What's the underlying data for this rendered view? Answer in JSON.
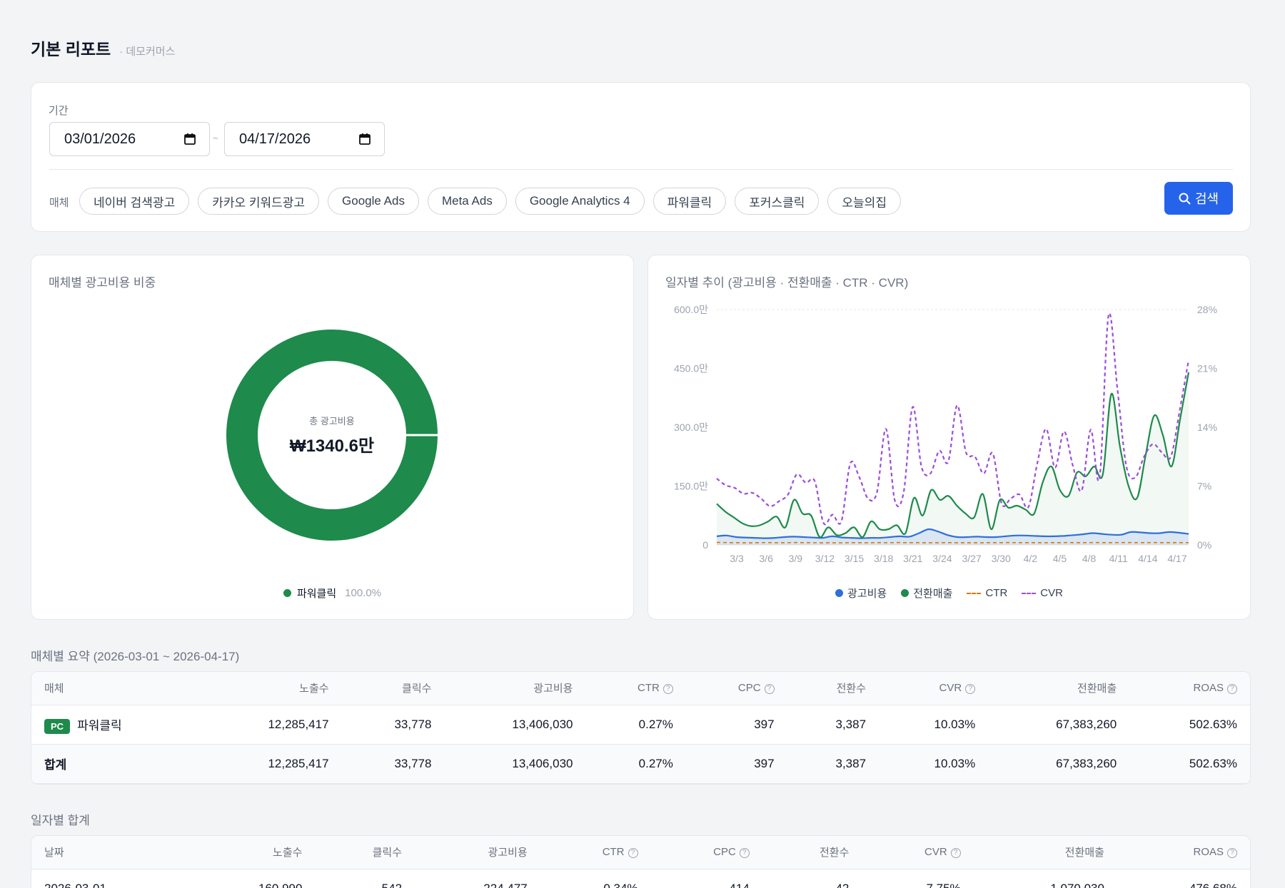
{
  "header": {
    "title": "기본 리포트",
    "subtitle": "· 데모커머스"
  },
  "filter": {
    "period_label": "기간",
    "date_start": "03/01/2026",
    "date_sep": "~",
    "date_end": "04/17/2026",
    "media_label": "매체",
    "chips": [
      "네이버 검색광고",
      "카카오 키워드광고",
      "Google Ads",
      "Meta Ads",
      "Google Analytics 4",
      "파워클릭",
      "포커스클릭",
      "오늘의집"
    ],
    "search_label": "검색",
    "accent_color": "#2563eb"
  },
  "donut": {
    "title": "매체별 광고비용 비중",
    "center_label": "총 광고비용",
    "center_value": "₩1340.6만",
    "legend": [
      {
        "name": "파워클릭",
        "pct": "100.0%",
        "color": "#1e8a4c"
      }
    ]
  },
  "line_chart": {
    "title": "일자별 추이 (광고비용 · 전환매출 · CTR · CVR)",
    "legend": [
      {
        "name": "광고비용",
        "color": "#2f6fdb",
        "style": "dot"
      },
      {
        "name": "전환매출",
        "color": "#1e8a4c",
        "style": "dot"
      },
      {
        "name": "CTR",
        "color": "#d97706",
        "style": "dash"
      },
      {
        "name": "CVR",
        "color": "#9b4ddb",
        "style": "dash"
      }
    ]
  },
  "chart_data": [
    {
      "type": "pie",
      "title": "매체별 광고비용 비중",
      "categories": [
        "파워클릭"
      ],
      "values": [
        100.0
      ],
      "style": "donut"
    },
    {
      "type": "line",
      "title": "일자별 추이 (광고비용 · 전환매출 · CTR · CVR)",
      "x_ticks": [
        "3/3",
        "3/6",
        "3/9",
        "3/12",
        "3/15",
        "3/18",
        "3/21",
        "3/24",
        "3/27",
        "3/30",
        "4/2",
        "4/5",
        "4/8",
        "4/11",
        "4/14",
        "4/17"
      ],
      "y_left_ticks": [
        "0",
        "150.0만",
        "300.0만",
        "450.0만",
        "600.0만"
      ],
      "y_left_lim": [
        0,
        600
      ],
      "y_right_ticks": [
        "0%",
        "7%",
        "14%",
        "21%",
        "28%"
      ],
      "y_right_lim": [
        0,
        28
      ],
      "series": [
        {
          "name": "광고비용",
          "axis": "left",
          "values": [
            22,
            24,
            20,
            19,
            18,
            17,
            18,
            20,
            21,
            20,
            19,
            18,
            22,
            19,
            18,
            17,
            18,
            18,
            20,
            22,
            21,
            30,
            40,
            34,
            25,
            20,
            20,
            21,
            20,
            20,
            22,
            24,
            24,
            23,
            22,
            22,
            23,
            25,
            27,
            30,
            28,
            26,
            26,
            33,
            32,
            30,
            30,
            33,
            31,
            28
          ]
        },
        {
          "name": "전환매출",
          "axis": "left",
          "values": [
            105,
            85,
            70,
            55,
            48,
            50,
            60,
            72,
            45,
            115,
            80,
            75,
            20,
            45,
            25,
            30,
            45,
            20,
            60,
            40,
            40,
            50,
            30,
            120,
            75,
            140,
            115,
            125,
            100,
            80,
            70,
            130,
            40,
            115,
            95,
            100,
            90,
            80,
            160,
            200,
            140,
            125,
            185,
            175,
            200,
            180,
            385,
            250,
            150,
            120,
            230,
            330,
            280,
            200,
            320,
            440
          ]
        },
        {
          "name": "CTR",
          "axis": "right",
          "values": [
            0.3,
            0.28,
            0.27,
            0.26,
            0.25,
            0.27,
            0.28,
            0.26,
            0.26,
            0.28,
            0.27,
            0.27,
            0.25,
            0.26,
            0.25,
            0.26,
            0.27,
            0.26,
            0.26,
            0.27,
            0.26,
            0.28,
            0.27,
            0.27,
            0.26,
            0.26,
            0.26,
            0.27,
            0.26,
            0.26,
            0.26,
            0.26,
            0.27,
            0.27,
            0.28,
            0.27,
            0.27,
            0.27,
            0.26,
            0.27,
            0.27,
            0.28,
            0.27,
            0.27,
            0.28,
            0.27,
            0.27,
            0.28,
            0.28,
            0.27,
            0.27,
            0.28,
            0.27,
            0.27,
            0.27,
            0.27
          ]
        },
        {
          "name": "CVR",
          "axis": "right",
          "values": [
            7.9,
            7.1,
            6.8,
            6.1,
            6.2,
            5.5,
            4.6,
            5.2,
            6.0,
            8.4,
            7.4,
            7.6,
            2.6,
            3.6,
            2.8,
            9.7,
            8.1,
            5.5,
            6.3,
            13.8,
            5.3,
            6.3,
            16.4,
            9.3,
            8.5,
            11.2,
            9.9,
            16.6,
            11.0,
            10.5,
            8.5,
            10.9,
            4.9,
            5.5,
            6.0,
            4.5,
            9.7,
            13.8,
            9.2,
            13.5,
            9.4,
            6.5,
            13.7,
            8.0,
            27.3,
            18.6,
            9.4,
            8.0,
            10.5,
            12.0,
            11.0,
            10.5,
            16.0,
            22.0
          ]
        }
      ]
    }
  ],
  "summary": {
    "title": "매체별 요약 (2026-03-01 ~ 2026-04-17)",
    "columns": [
      "매체",
      "노출수",
      "클릭수",
      "광고비용",
      "CTR",
      "CPC",
      "전환수",
      "CVR",
      "전환매출",
      "ROAS"
    ],
    "help_columns": [
      4,
      5,
      7,
      9
    ],
    "rows": [
      {
        "badge": "PC",
        "name": "파워클릭",
        "cells": [
          "12,285,417",
          "33,778",
          "13,406,030",
          "0.27%",
          "397",
          "3,387",
          "10.03%",
          "67,383,260",
          "502.63%"
        ]
      }
    ],
    "total": {
      "name": "합계",
      "cells": [
        "12,285,417",
        "33,778",
        "13,406,030",
        "0.27%",
        "397",
        "3,387",
        "10.03%",
        "67,383,260",
        "502.63%"
      ]
    }
  },
  "daily": {
    "title": "일자별 합계",
    "columns": [
      "날짜",
      "노출수",
      "클릭수",
      "광고비용",
      "CTR",
      "CPC",
      "전환수",
      "CVR",
      "전환매출",
      "ROAS"
    ],
    "help_columns": [
      4,
      5,
      7,
      9
    ],
    "rows": [
      {
        "cells": [
          "2026-03-01",
          "160,990",
          "542",
          "224,477",
          "0.34%",
          "414",
          "42",
          "7.75%",
          "1,070,030",
          "476.68%"
        ]
      }
    ]
  }
}
